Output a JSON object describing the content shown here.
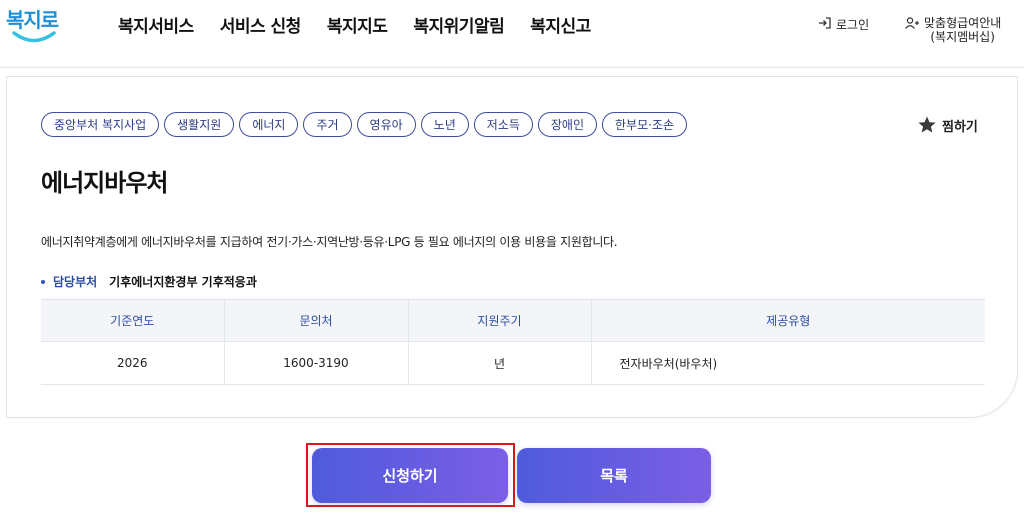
{
  "header": {
    "logo": {
      "text": "복지로",
      "colors": {
        "primary": "#1e8fd6",
        "accent": "#37c1e0"
      }
    },
    "nav": [
      "복지서비스",
      "서비스 신청",
      "복지지도",
      "복지위기알림",
      "복지신고"
    ],
    "login_label": "로그인",
    "guide_label_1": "맞춤형급여안내",
    "guide_label_2": "(복지멤버십)"
  },
  "service": {
    "tags": [
      "중앙부처 복지사업",
      "생활지원",
      "에너지",
      "주거",
      "영유아",
      "노년",
      "저소득",
      "장애인",
      "한부모·조손"
    ],
    "favorite_label": "찜하기",
    "title": "에너지바우처",
    "description": "에너지취약계층에게 에너지바우처를 지급하여 전기·가스·지역난방·등유·LPG 등 필요 에너지의 이용 비용을 지원합니다.",
    "dept_label": "담당부처",
    "dept_value": "기후에너지환경부 기후적응과",
    "table": {
      "headers": [
        "기준연도",
        "문의처",
        "지원주기",
        "제공유형"
      ],
      "row": [
        "2026",
        "1600-3190",
        "년",
        "전자바우처(바우처)"
      ]
    }
  },
  "actions": {
    "apply_label": "신청하기",
    "list_label": "목록"
  },
  "colors": {
    "tag_border": "#3d4f9e",
    "button_gradient_start": "#4f5bdc",
    "button_gradient_end": "#7b5ee6",
    "highlight": "#e0141c"
  }
}
